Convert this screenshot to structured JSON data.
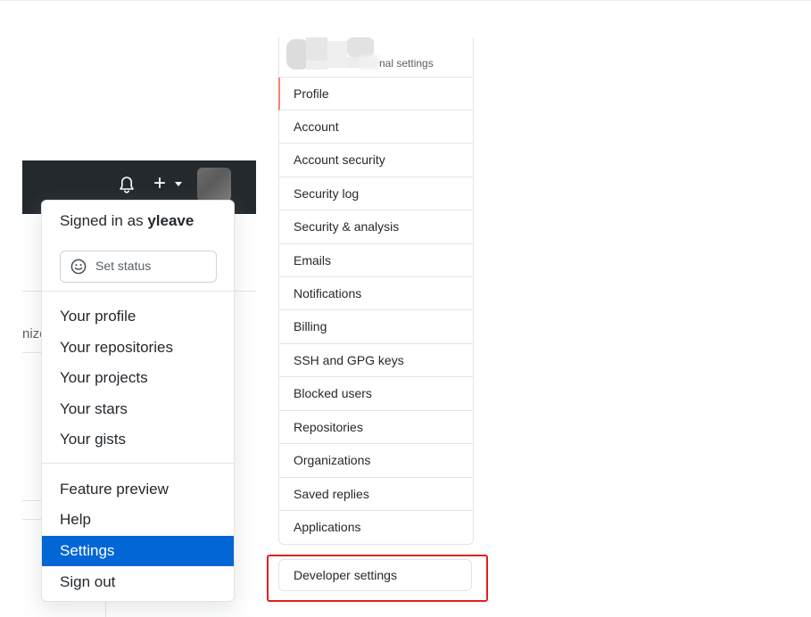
{
  "user_menu": {
    "signed_in_prefix": "Signed in as",
    "username": "yleave",
    "set_status": "Set status",
    "items_group1": [
      "Your profile",
      "Your repositories",
      "Your projects",
      "Your stars",
      "Your gists"
    ],
    "items_group2": [
      "Feature preview",
      "Help",
      "Settings",
      "Sign out"
    ],
    "active_item": "Settings"
  },
  "header": {
    "icons": [
      "bell-icon",
      "plus-icon",
      "caret-down-icon",
      "avatar"
    ],
    "background": "#24292e"
  },
  "background_page": {
    "partial_text": "nize"
  },
  "settings_nav": {
    "header_partial_label": "nal settings",
    "items": [
      "Profile",
      "Account",
      "Account security",
      "Security log",
      "Security & analysis",
      "Emails",
      "Notifications",
      "Billing",
      "SSH and GPG keys",
      "Blocked users",
      "Repositories",
      "Organizations",
      "Saved replies",
      "Applications"
    ],
    "selected_item": "Profile",
    "developer_settings": "Developer settings"
  },
  "colors": {
    "accent_blue": "#0366d6",
    "selected_marker": "#f9826c",
    "highlight_box": "#e02020"
  }
}
